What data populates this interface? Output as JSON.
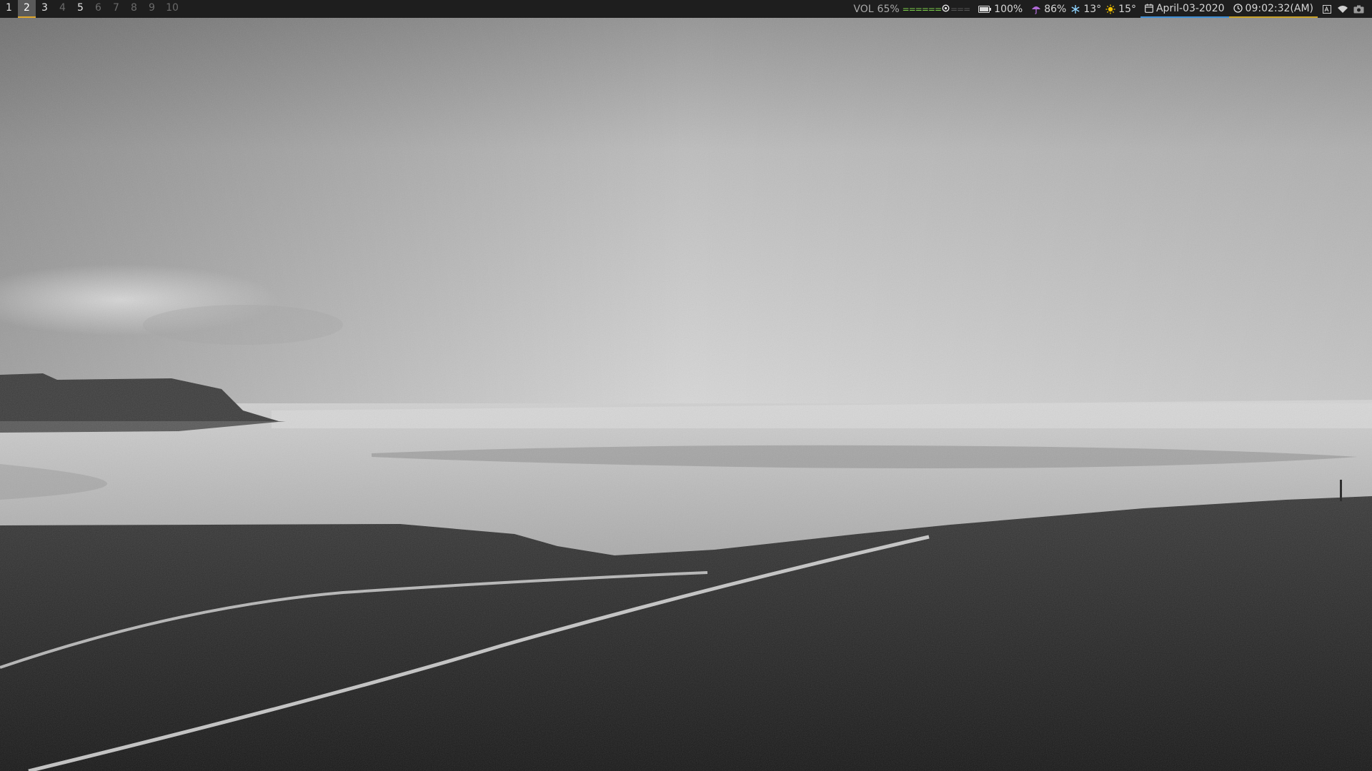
{
  "workspaces": [
    {
      "label": "1",
      "state": "occupied"
    },
    {
      "label": "2",
      "state": "active"
    },
    {
      "label": "3",
      "state": "occupied"
    },
    {
      "label": "4",
      "state": "empty"
    },
    {
      "label": "5",
      "state": "occupied"
    },
    {
      "label": "6",
      "state": "empty"
    },
    {
      "label": "7",
      "state": "empty"
    },
    {
      "label": "8",
      "state": "empty"
    },
    {
      "label": "9",
      "state": "empty"
    },
    {
      "label": "10",
      "state": "empty"
    }
  ],
  "status": {
    "volume": {
      "label": "VOL",
      "percent_text": "65%",
      "bar_filled": "======",
      "bar_empty": "===",
      "level": 0.65
    },
    "battery": {
      "icon": "battery-icon",
      "text": "100%"
    },
    "weather": {
      "rain_icon": "umbrella-icon",
      "humidity_text": "86%",
      "cold_icon": "snowflake-icon",
      "low_text": "13°",
      "warm_icon": "sun-icon",
      "high_text": "15°"
    },
    "date": {
      "icon": "calendar-icon",
      "text": "April-03-2020"
    },
    "time": {
      "icon": "clock-icon",
      "text": "09:02:32(AM)"
    },
    "tray": [
      "keyboard-layout-icon",
      "wifi-icon",
      "camera-icon"
    ]
  },
  "colors": {
    "bar_bg": "#1e1e1e",
    "active_ws_bg": "#5a5a5a",
    "active_ws_underline": "#e0a72a",
    "volume_bar": "#7ccf4a",
    "date_underline": "#3f8fd6",
    "time_underline": "#c9a227"
  },
  "wallpaper": {
    "description_icon": "landscape-wallpaper"
  }
}
